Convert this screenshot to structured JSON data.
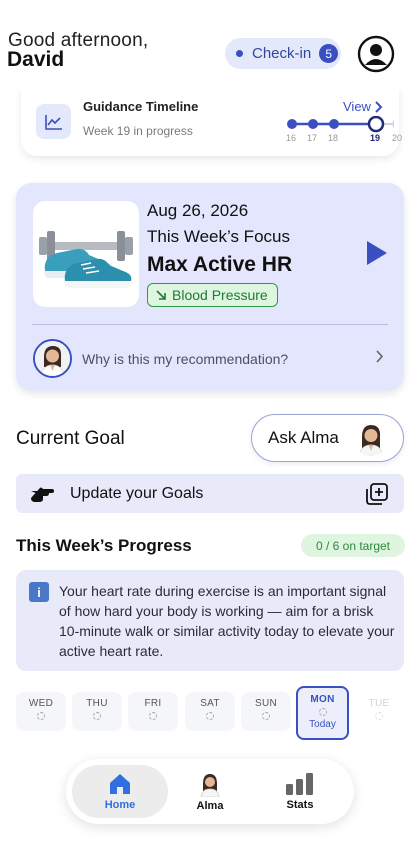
{
  "header": {
    "greeting": "Good afternoon,",
    "name": "David",
    "checkin_label": "Check-in",
    "checkin_count": "5"
  },
  "timeline": {
    "title": "Guidance Timeline",
    "subtitle": "Week 19 in progress",
    "view_label": "View",
    "weeks": [
      "16",
      "17",
      "18",
      "19",
      "20"
    ],
    "current_week": "19"
  },
  "focus": {
    "date": "Aug 26, 2026",
    "subtitle": "This Week’s Focus",
    "title": "Max Active HR",
    "tag": "Blood Pressure",
    "why_label": "Why is this my recommendation?"
  },
  "goal": {
    "title": "Current Goal",
    "ask_label": "Ask Alma",
    "update_label": "Update your Goals"
  },
  "progress": {
    "title": "This Week’s Progress",
    "badge": "0 / 6 on target",
    "info": "Your heart rate during exercise is an important signal of how hard your body is working — aim for a brisk 10-minute walk or similar activity today to elevate your active heart rate."
  },
  "days": [
    {
      "name": "WED"
    },
    {
      "name": "THU"
    },
    {
      "name": "FRI"
    },
    {
      "name": "SAT"
    },
    {
      "name": "SUN"
    },
    {
      "name": "MON",
      "today_label": "Today"
    },
    {
      "name": "TUE"
    }
  ],
  "nav": {
    "home": "Home",
    "alma": "Alma",
    "stats": "Stats"
  },
  "colors": {
    "accent": "#3a4fc0",
    "card_bg": "#e3e6fc",
    "success": "#2f9a4a",
    "nav_active": "#2f6fe0"
  },
  "icons": [
    "profile-icon",
    "trend-chart-icon",
    "chevron-right-icon",
    "play-icon",
    "arrow-down-right-icon",
    "pointing-hand-icon",
    "add-copy-icon",
    "info-icon",
    "home-icon",
    "stats-icon"
  ]
}
